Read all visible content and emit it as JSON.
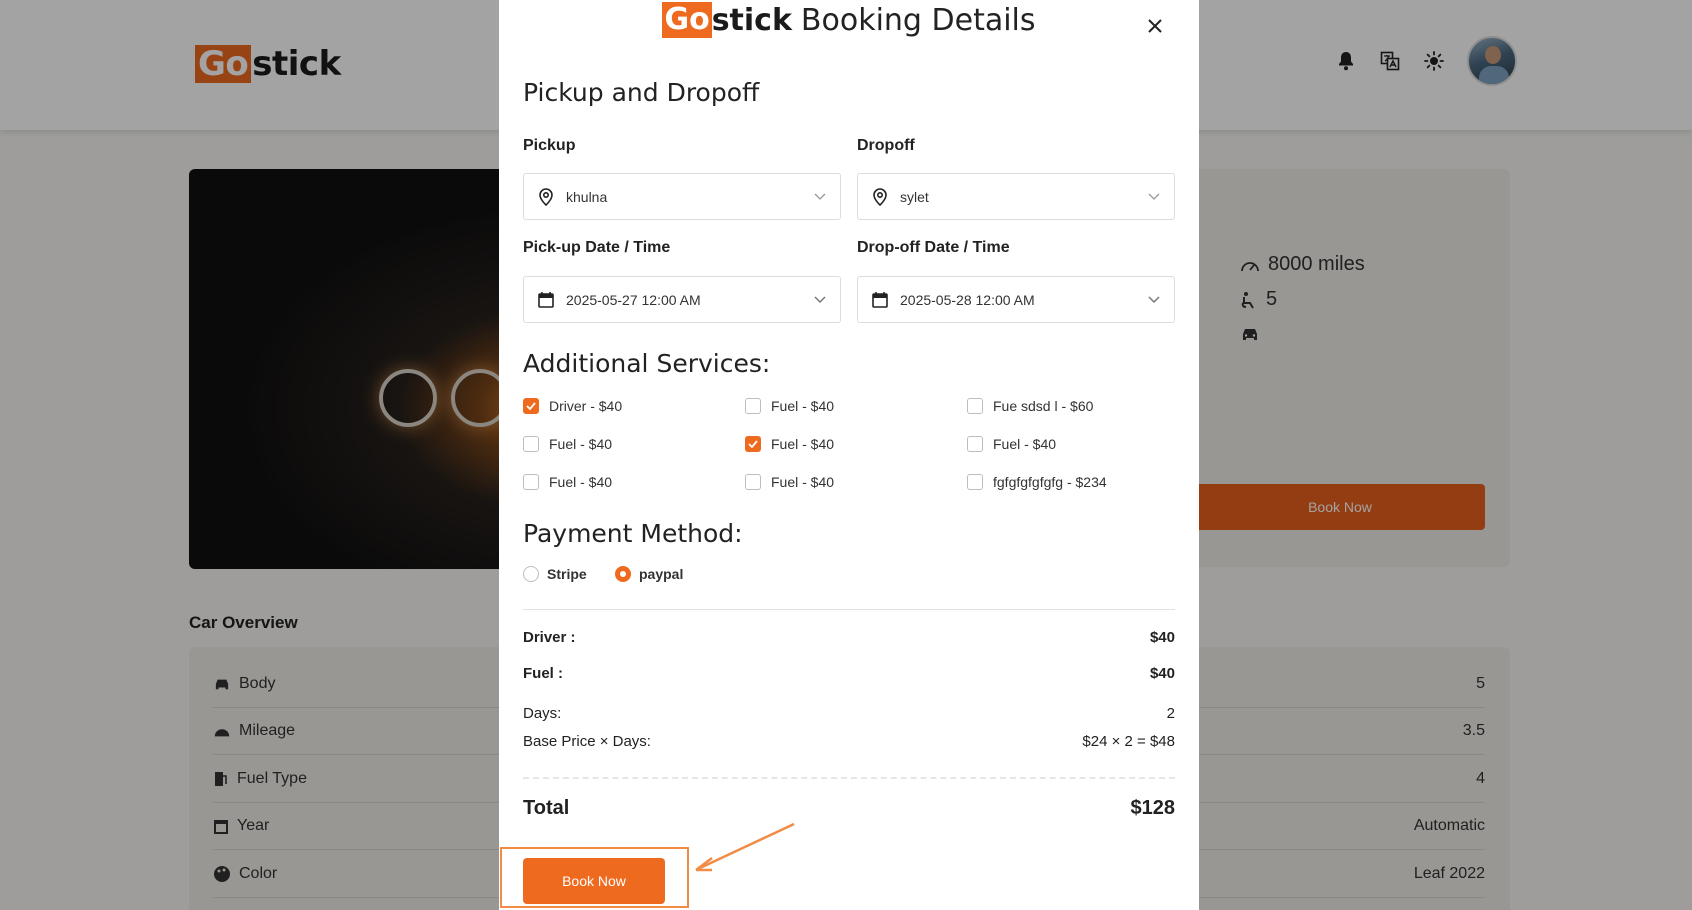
{
  "brand": {
    "logo_go": "Go",
    "logo_stick": "stick"
  },
  "background": {
    "specs": {
      "mileage": "8000 miles",
      "seats": "5"
    },
    "book_now": "Book Now",
    "overview_title": "Car Overview",
    "overview_rows": [
      {
        "label": "Body",
        "value": "5"
      },
      {
        "label": "Mileage",
        "value": "3.5"
      },
      {
        "label": "Fuel Type",
        "value": "4"
      },
      {
        "label": "Year",
        "value": "Automatic"
      },
      {
        "label": "Color",
        "value": "Leaf 2022"
      }
    ]
  },
  "modal": {
    "title_go": "Go",
    "title_stick": "stick",
    "title_rest": "Booking Details",
    "section_pickup": "Pickup and Dropoff",
    "pickup_label": "Pickup",
    "pickup_value": "khulna",
    "dropoff_label": "Dropoff",
    "dropoff_value": "sylet",
    "pickup_dt_label": "Pick-up Date / Time",
    "pickup_dt_value": "2025-05-27 12:00 AM",
    "dropoff_dt_label": "Drop-off Date / Time",
    "dropoff_dt_value": "2025-05-28 12:00 AM",
    "section_services": "Additional Services:",
    "services": [
      {
        "label": "Driver - $40",
        "checked": true
      },
      {
        "label": "Fuel - $40",
        "checked": false
      },
      {
        "label": "Fue sdsd l - $60",
        "checked": false
      },
      {
        "label": "Fuel - $40",
        "checked": false
      },
      {
        "label": "Fuel - $40",
        "checked": true
      },
      {
        "label": "Fuel - $40",
        "checked": false
      },
      {
        "label": "Fuel - $40",
        "checked": false
      },
      {
        "label": "Fuel - $40",
        "checked": false
      },
      {
        "label": "fgfgfgfgfgfg - $234",
        "checked": false
      }
    ],
    "section_payment": "Payment Method:",
    "payment_options": [
      {
        "label": "Stripe",
        "selected": false
      },
      {
        "label": "paypal",
        "selected": true
      }
    ],
    "summary": {
      "driver_label": "Driver :",
      "driver_value": "$40",
      "fuel_label": "Fuel :",
      "fuel_value": "$40",
      "days_label": "Days:",
      "days_value": "2",
      "base_label": "Base Price × Days:",
      "base_value": "$24 × 2 = $48",
      "total_label": "Total",
      "total_value": "$128"
    },
    "book_now": "Book Now"
  },
  "colors": {
    "accent": "#ee6a1f",
    "highlight": "#f28b46"
  }
}
